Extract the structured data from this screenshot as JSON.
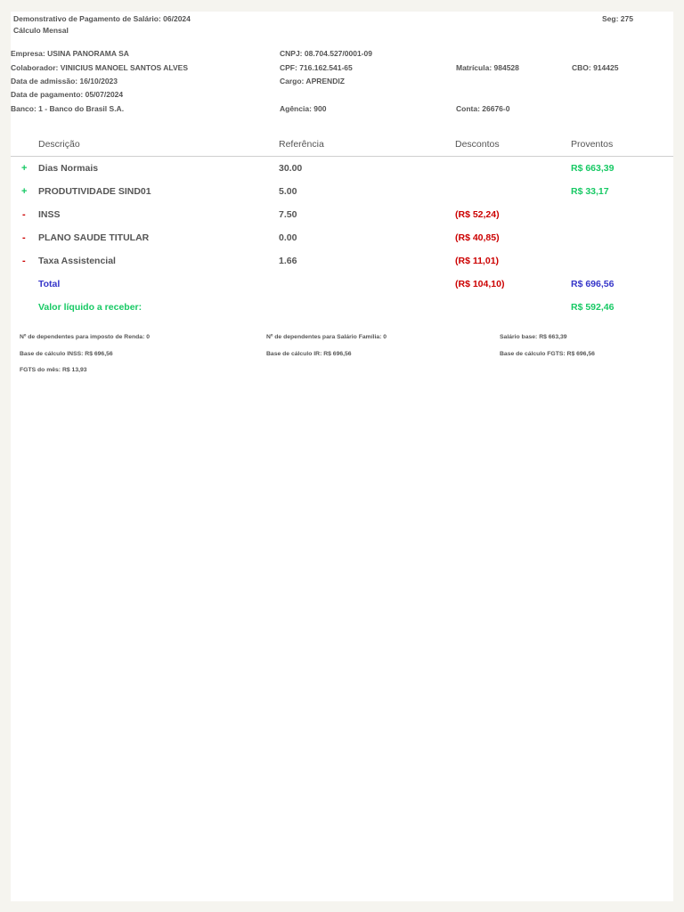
{
  "header": {
    "title": "Demonstrativo de Pagamento de Salário: 06/2024",
    "subtitle": "Cálculo Mensal",
    "seg": "Seg: 275"
  },
  "info": {
    "empresa": "Empresa: USINA PANORAMA SA",
    "cnpj": "CNPJ: 08.704.527/0001-09",
    "colaborador": "Colaborador: VINICIUS MANOEL SANTOS ALVES",
    "cpf": "CPF: 716.162.541-65",
    "matricula": "Matrícula: 984528",
    "cbo": "CBO: 914425",
    "admissao": "Data de admissão: 16/10/2023",
    "cargo": "Cargo: APRENDIZ",
    "pagamento": "Data de pagamento: 05/07/2024",
    "banco": "Banco: 1 - Banco do Brasil S.A.",
    "agencia": "Agência: 900",
    "conta": "Conta: 26676-0"
  },
  "table": {
    "headers": {
      "descricao": "Descrição",
      "referencia": "Referência",
      "descontos": "Descontos",
      "proventos": "Proventos"
    },
    "rows": [
      {
        "sign": "+",
        "descricao": "Dias Normais",
        "referencia": "30.00",
        "descontos": "",
        "proventos": "R$ 663,39"
      },
      {
        "sign": "+",
        "descricao": "PRODUTIVIDADE SIND01",
        "referencia": "5.00",
        "descontos": "",
        "proventos": "R$ 33,17"
      },
      {
        "sign": "-",
        "descricao": "INSS",
        "referencia": "7.50",
        "descontos": "(R$ 52,24)",
        "proventos": ""
      },
      {
        "sign": "-",
        "descricao": "PLANO SAUDE TITULAR",
        "referencia": "0.00",
        "descontos": "(R$ 40,85)",
        "proventos": ""
      },
      {
        "sign": "-",
        "descricao": "Taxa Assistencial",
        "referencia": "1.66",
        "descontos": "(R$ 11,01)",
        "proventos": ""
      }
    ],
    "total": {
      "label": "Total",
      "descontos": "(R$ 104,10)",
      "proventos": "R$ 696,56"
    },
    "liquido": {
      "label": "Valor líquido a receber:",
      "value": "R$ 592,46"
    }
  },
  "footer": {
    "dep_ir": "Nº de dependentes para imposto de Renda: 0",
    "dep_sf": "Nº de dependentes para Salário Família: 0",
    "salario_base": "Salário base: R$ 663,39",
    "base_inss": "Base de cálculo INSS: R$ 696,56",
    "base_ir": "Base de cálculo IR: R$ 696,56",
    "base_fgts": "Base de cálculo FGTS: R$ 696,56",
    "fgts_mes": "FGTS do mês: R$ 13,93"
  },
  "colors": {
    "positive": "#17c964",
    "negative": "#cc0000",
    "total": "#3535c9"
  }
}
